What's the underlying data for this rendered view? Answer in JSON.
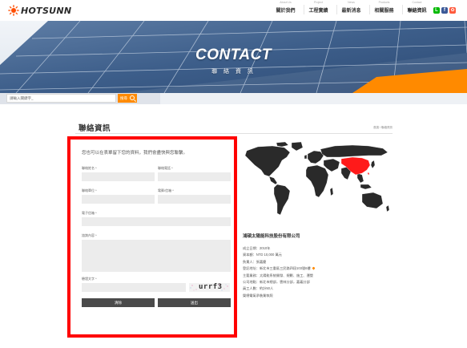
{
  "brand": {
    "name": "HOTSUNN",
    "logo_colors": [
      "#ff4d00",
      "#3a3a3a"
    ]
  },
  "nav": {
    "items": [
      {
        "en": "About Us",
        "zh": "關於我們"
      },
      {
        "en": "Project",
        "zh": "工程實績"
      },
      {
        "en": "News",
        "zh": "最新消息"
      },
      {
        "en": "Products",
        "zh": "相關服務"
      },
      {
        "en": "Contact",
        "zh": "聯絡資訊"
      }
    ],
    "active_index": 4
  },
  "social": [
    {
      "icon": "line-icon",
      "color": "#00b900",
      "glyph": "L"
    },
    {
      "icon": "facebook-icon",
      "color": "#3b5998",
      "glyph": "f"
    },
    {
      "icon": "share-icon",
      "color": "#ff5a3c",
      "glyph": "✿"
    }
  ],
  "banner": {
    "title": "CONTACT",
    "subtitle": "聯 絡 資 訊"
  },
  "search": {
    "placeholder": "請輸入關鍵字_",
    "button_label": "搜尋"
  },
  "section": {
    "title": "聯絡資訊",
    "breadcrumb": "首頁 / 聯絡資訊"
  },
  "form": {
    "intro": "您也可以在表單留下您的資料，我們會盡快與您聯繫。",
    "fields": {
      "name": "聯絡姓名 *",
      "phone": "聯絡電話 *",
      "company": "聯絡單位 *",
      "email": "電郵/信箱 *",
      "mobile": "電子信箱 *",
      "message": "諮詢內容 *",
      "captcha": "驗證文字 *"
    },
    "captcha_text": "urrf3",
    "buttons": {
      "clear": "清除",
      "submit": "送出"
    }
  },
  "company": {
    "name": "鴻碩太陽能科技股份有限公司",
    "info": [
      "成立日期：2010年",
      "資本額：NTD 10,000 萬元",
      "負責人：張嘉慶",
      "登記地址：新北市三重區三民路四段103號6樓",
      "主要業務：太陽能系統開發、規劃、施工、運營",
      "公司地點：新北市總部，雲林分部，嘉義分部",
      "員工人數：約計50人",
      "榮總電氣承裝業執照"
    ]
  },
  "colors": {
    "accent": "#ff8a00",
    "highlight": "#ff0000",
    "map_land": "#2a2a2a",
    "map_china": "#ff1a1a"
  }
}
